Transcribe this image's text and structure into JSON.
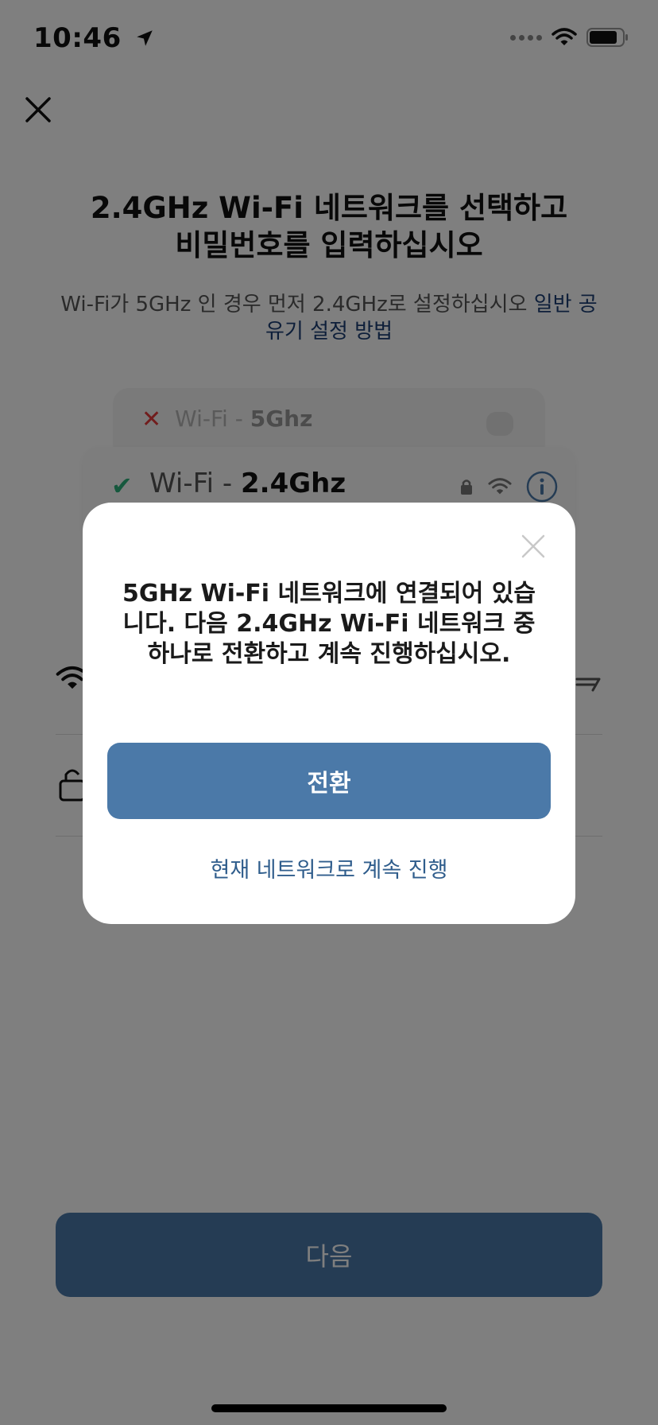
{
  "status_bar": {
    "time": "10:46"
  },
  "header": {
    "title_line1": "2.4GHz Wi-Fi 네트워크를 선택하고",
    "title_line2": "비밀번호를 입력하십시오",
    "subtitle_text": "Wi-Fi가 5GHz 인 경우 먼저 2.4GHz로 설정하십시오 ",
    "subtitle_link": "일반 공유기 설정 방법"
  },
  "wifi_cards": {
    "bad_prefix": "Wi-Fi - ",
    "bad_band": "5Ghz",
    "good_prefix": "Wi-Fi - ",
    "good_band": "2.4Ghz"
  },
  "next_button": {
    "label": "다음"
  },
  "modal": {
    "message": "5GHz Wi-Fi 네트워크에 연결되어 있습니다. 다음 2.4GHz Wi-Fi 네트워크 중 하나로 전환하고 계속 진행하십시오.",
    "switch_label": "전환",
    "continue_label": "현재 네트워크로 계속 진행"
  },
  "colors": {
    "accent": "#4b79a8",
    "link": "#1d3f74",
    "success": "#2db07a",
    "error": "#e23a3a"
  }
}
